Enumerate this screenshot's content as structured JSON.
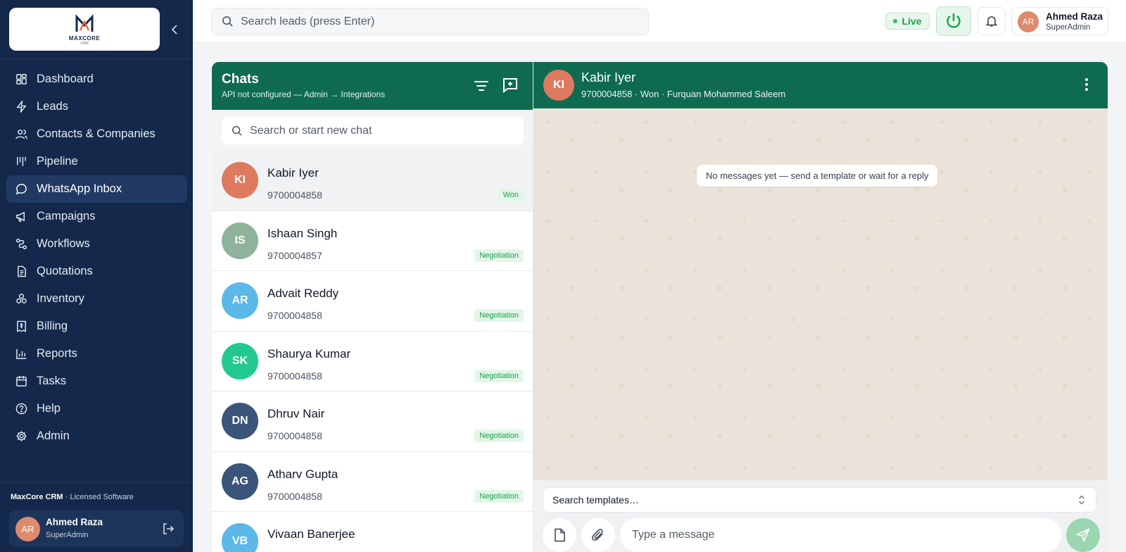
{
  "brand": {
    "logo_name": "MAXCORE",
    "logo_sub": "CRM",
    "footer_name": "MaxCore CRM",
    "footer_tag": "Licensed Software",
    "colors": {
      "sidebar": "#13284a",
      "accent": "#0f6b50",
      "live": "#16a34a"
    }
  },
  "sidebar": {
    "items": [
      {
        "label": "Dashboard",
        "icon": "dashboard-icon"
      },
      {
        "label": "Leads",
        "icon": "bolt-icon"
      },
      {
        "label": "Contacts & Companies",
        "icon": "users-icon"
      },
      {
        "label": "Pipeline",
        "icon": "pipeline-icon"
      },
      {
        "label": "WhatsApp Inbox",
        "icon": "chat-bubble-icon",
        "active": true
      },
      {
        "label": "Campaigns",
        "icon": "megaphone-icon"
      },
      {
        "label": "Workflows",
        "icon": "workflow-icon"
      },
      {
        "label": "Quotations",
        "icon": "document-icon"
      },
      {
        "label": "Inventory",
        "icon": "boxes-icon"
      },
      {
        "label": "Billing",
        "icon": "receipt-icon"
      },
      {
        "label": "Reports",
        "icon": "bar-chart-icon"
      },
      {
        "label": "Tasks",
        "icon": "calendar-icon"
      },
      {
        "label": "Help",
        "icon": "help-icon"
      },
      {
        "label": "Admin",
        "icon": "gear-icon"
      }
    ],
    "user": {
      "initials": "AR",
      "name": "Ahmed Raza",
      "role": "SuperAdmin"
    }
  },
  "topbar": {
    "search_placeholder": "Search leads (press Enter)",
    "live_label": "Live",
    "user": {
      "initials": "AR",
      "name": "Ahmed Raza",
      "role": "SuperAdmin"
    }
  },
  "chats": {
    "title": "Chats",
    "subtitle": "API not configured — Admin → Integrations",
    "search_placeholder": "Search or start new chat",
    "list": [
      {
        "initials": "KI",
        "name": "Kabir Iyer",
        "phone": "9700004858",
        "stage": "Won",
        "color": "#de7a5f",
        "selected": true
      },
      {
        "initials": "IS",
        "name": "Ishaan Singh",
        "phone": "9700004857",
        "stage": "Negotiation",
        "color": "#8fb39a"
      },
      {
        "initials": "AR",
        "name": "Advait Reddy",
        "phone": "9700004858",
        "stage": "Negotiation",
        "color": "#5bb8e8"
      },
      {
        "initials": "SK",
        "name": "Shaurya Kumar",
        "phone": "9700004858",
        "stage": "Negotiation",
        "color": "#21c98e"
      },
      {
        "initials": "DN",
        "name": "Dhruv Nair",
        "phone": "9700004858",
        "stage": "Negotiation",
        "color": "#3b5479"
      },
      {
        "initials": "AG",
        "name": "Atharv Gupta",
        "phone": "9700004858",
        "stage": "Negotiation",
        "color": "#3b5479"
      },
      {
        "initials": "VB",
        "name": "Vivaan Banerjee",
        "phone": "",
        "stage": "",
        "color": "#5bb8e8"
      }
    ]
  },
  "conversation": {
    "initials": "KI",
    "name": "Kabir Iyer",
    "subtitle": "9700004858 · Won · Furquan Mohammed Saleem",
    "empty_message": "No messages yet — send a template or wait for a reply",
    "template_placeholder": "Search templates…",
    "message_placeholder": "Type a message"
  }
}
